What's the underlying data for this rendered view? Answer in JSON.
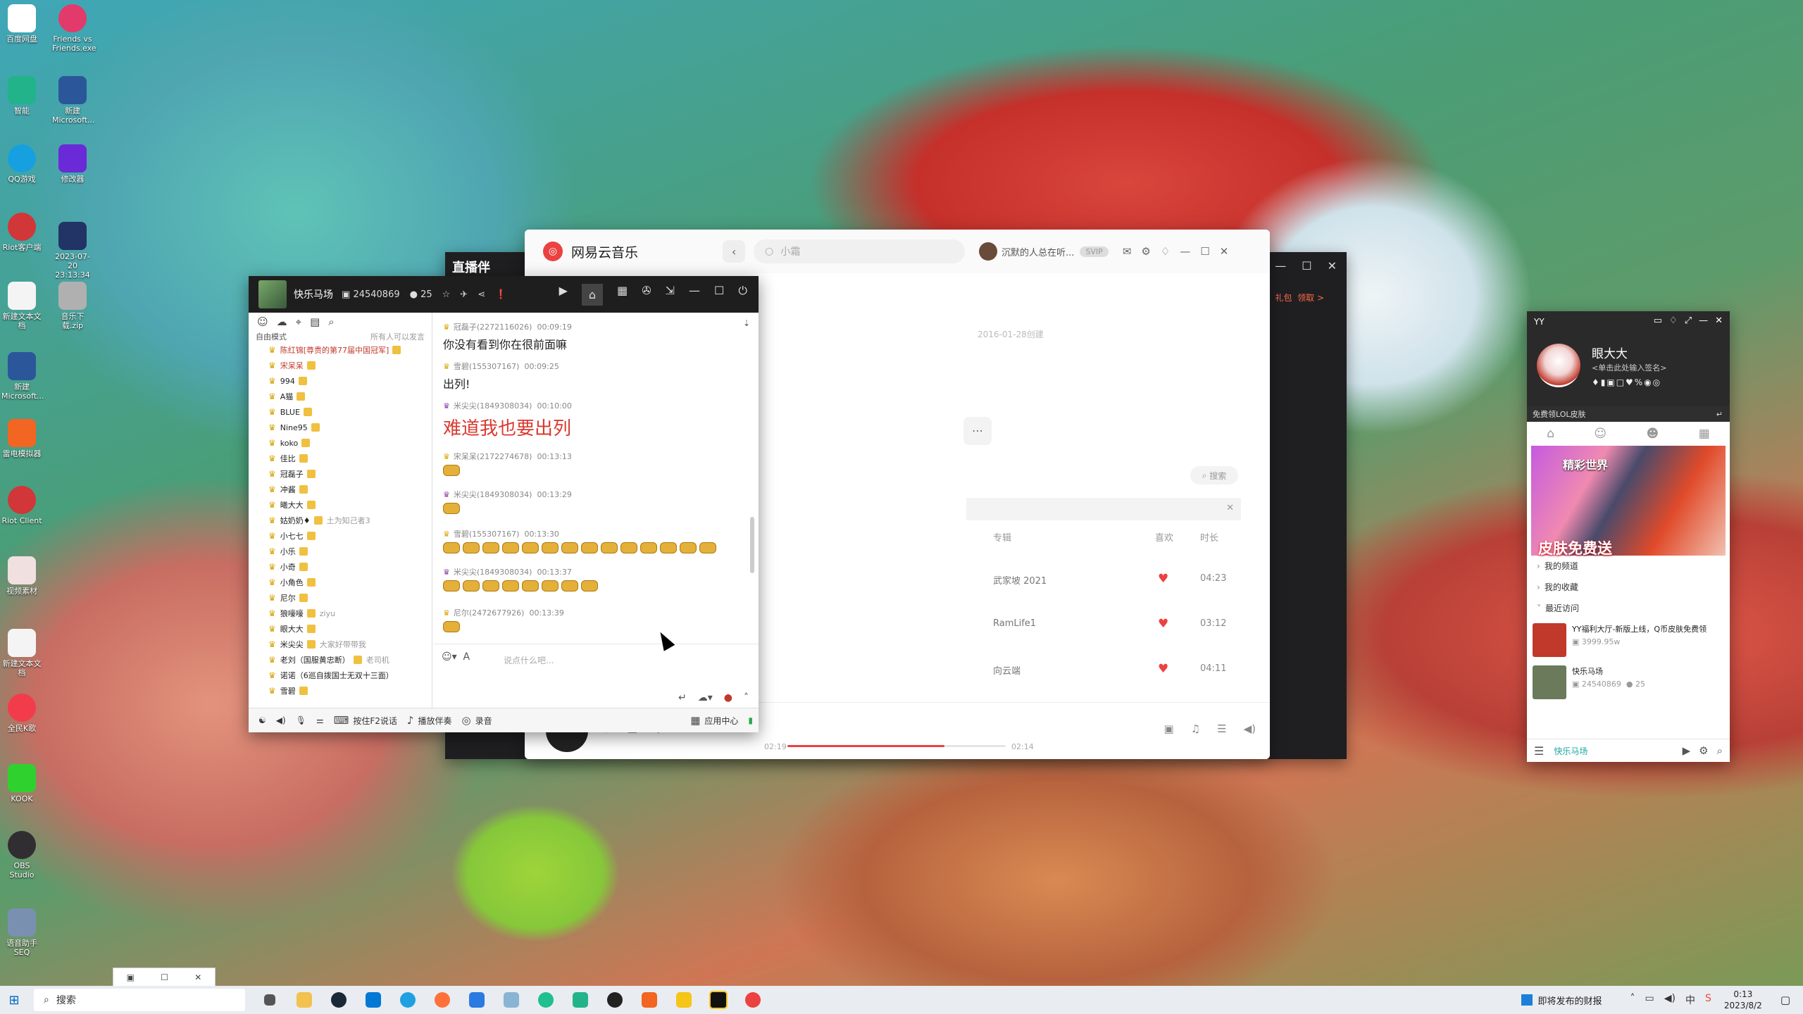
{
  "desktop": {
    "icons": [
      {
        "label": "百度网盘",
        "color": "#ffffff"
      },
      {
        "label": "Friends vs Friends.exe",
        "color": "#e23a6a"
      },
      {
        "label": "智能",
        "color": "#22b38a"
      },
      {
        "label": "新建 Microsoft...",
        "color": "#2b579a"
      },
      {
        "label": "QQ游戏",
        "color": "#16a0e0"
      },
      {
        "label": "修改器",
        "color": "#6a2ad8"
      },
      {
        "label": "Riot客户端",
        "color": "#d13639"
      },
      {
        "label": "2023-07-20 23:13:34",
        "color": "#223366"
      },
      {
        "label": "新建文本文档",
        "color": "#f4f4f4"
      },
      {
        "label": "音乐下载.zip",
        "color": "#b0b0b0"
      },
      {
        "label": "新建 Microsoft...",
        "color": "#2b579a"
      },
      {
        "label": "雷电模拟器",
        "color": "#f26522"
      },
      {
        "label": "Riot Client",
        "color": "#d13639"
      },
      {
        "label": "视频素材",
        "color": "#f0e0e0"
      },
      {
        "label": "新建文本文档",
        "color": "#f4f4f4"
      },
      {
        "label": "全民K歌",
        "color": "#f23c4c"
      },
      {
        "label": "KOOK",
        "color": "#2fd12f"
      },
      {
        "label": "OBS Studio",
        "color": "#302e31"
      },
      {
        "label": "语音助手SEQ",
        "color": "#7a90b0"
      }
    ]
  },
  "netease": {
    "title": "网易云音乐",
    "search_placeholder": "小霜",
    "user": "沉默的人总在听...",
    "vip": "SVIP",
    "date": "2016-01-28创建",
    "search_small": "搜索",
    "header": {
      "album": "专辑",
      "like": "喜欢",
      "duration": "时长"
    },
    "rows": [
      {
        "album": "武家坡 2021",
        "duration": "04:23"
      },
      {
        "album": "RamLife1",
        "duration": "03:12"
      },
      {
        "album": "向云端",
        "duration": "04:11"
      }
    ],
    "player": {
      "elapsed": "02:19",
      "total": "02:14",
      "progress": 0.72
    }
  },
  "dark_window": {
    "title": "直播伴",
    "link1": "礼包",
    "link2": "领取 >"
  },
  "yychat": {
    "channel_name": "快乐马场",
    "channel_id": "24540869",
    "online": "25",
    "mode_label": "自由模式",
    "mode_right": "所有人可以发言",
    "members": [
      {
        "name": "陈红锦[尊贵的第77届中国冠军]",
        "sub": ""
      },
      {
        "name": "宋呆呆",
        "sub": ""
      },
      {
        "name": "994",
        "sub": ""
      },
      {
        "name": "A猫",
        "sub": ""
      },
      {
        "name": "BLUE",
        "sub": ""
      },
      {
        "name": "Nine95",
        "sub": ""
      },
      {
        "name": "koko",
        "sub": ""
      },
      {
        "name": "佳比",
        "sub": ""
      },
      {
        "name": "冠磊子",
        "sub": ""
      },
      {
        "name": "冲酱",
        "sub": ""
      },
      {
        "name": "曦大大",
        "sub": ""
      },
      {
        "name": "姑奶奶♦",
        "sub": "土为知己者3"
      },
      {
        "name": "小七七",
        "sub": ""
      },
      {
        "name": "小乐",
        "sub": ""
      },
      {
        "name": "小奇",
        "sub": ""
      },
      {
        "name": "小角色",
        "sub": ""
      },
      {
        "name": "尼尔",
        "sub": ""
      },
      {
        "name": "狼嚎嚎",
        "sub": "ziyu"
      },
      {
        "name": "眼大大",
        "sub": ""
      },
      {
        "name": "米尖尖",
        "sub": "大家好带带我"
      },
      {
        "name": "老刘（国服黄忠断）",
        "sub": "老司机"
      },
      {
        "name": "诺诺（6巡自拨国士无双十三面）",
        "sub": ""
      },
      {
        "name": "雪碧",
        "sub": ""
      }
    ],
    "messages": [
      {
        "user": "冠磊子(2272116026)",
        "time": "00:09:19",
        "text": "你没有看到你在很前面嘛"
      },
      {
        "user": "雪碧(155307167)",
        "time": "00:09:25",
        "text": "出列!"
      },
      {
        "user": "米尖尖(1849308034)",
        "time": "00:10:00",
        "text": "难道我也要出列"
      },
      {
        "user": "宋呆呆(2172274678)",
        "time": "00:13:13",
        "text": ""
      },
      {
        "user": "米尖尖(1849308034)",
        "time": "00:13:29",
        "text": ""
      },
      {
        "user": "雪碧(155307167)",
        "time": "00:13:30",
        "text": ""
      },
      {
        "user": "米尖尖(1849308034)",
        "time": "00:13:37",
        "text": ""
      },
      {
        "user": "尼尔(2472677926)",
        "time": "00:13:39",
        "text": ""
      }
    ],
    "input_placeholder": "说点什么吧...",
    "bottom": {
      "f2": "按住F2说话",
      "accomp": "播放伴奏",
      "record": "录音",
      "apps": "应用中心"
    }
  },
  "yyside": {
    "logo": "YY",
    "name": "眼大大",
    "signature": "<单击此处输入签名>",
    "sub_left": "免费领LOL皮肤",
    "banner_top": "精彩世界",
    "banner_bottom": "皮肤免费送",
    "menu": [
      "我的频道",
      "我的收藏",
      "最近访问"
    ],
    "recent": [
      {
        "title": "YY福利大厅-新版上线，Q币皮肤免费领",
        "sub": "3999.95w"
      },
      {
        "title": "快乐马场",
        "sub": "24540869",
        "count": "25"
      }
    ],
    "bottom_name": "快乐马场"
  },
  "taskbar": {
    "search": "搜索",
    "news": "即将发布的财报",
    "time": "0:13",
    "date": "2023/8/2"
  }
}
